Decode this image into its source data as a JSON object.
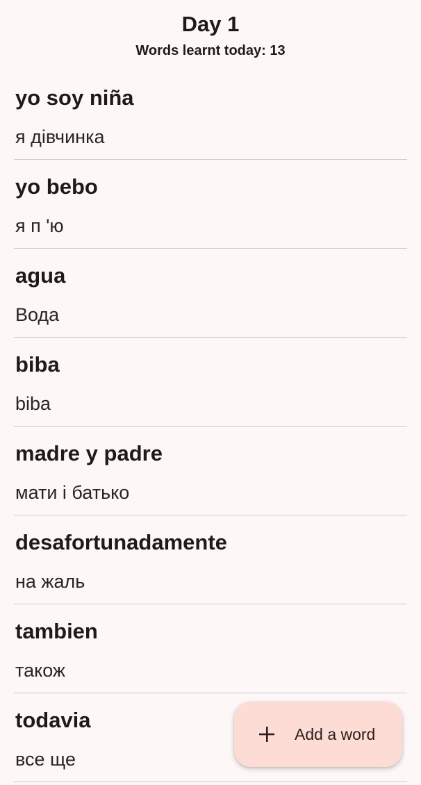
{
  "header": {
    "title": "Day 1",
    "subtitle": "Words learnt today: 13"
  },
  "words": [
    {
      "term": "yo soy niña",
      "translation": "я дівчинка"
    },
    {
      "term": "yo bebo",
      "translation": "я п 'ю"
    },
    {
      "term": "agua",
      "translation": "Вода"
    },
    {
      "term": "biba",
      "translation": "biba"
    },
    {
      "term": "madre y padre",
      "translation": "мати і батько"
    },
    {
      "term": "desafortunadamente",
      "translation": "на жаль"
    },
    {
      "term": "tambien",
      "translation": "також"
    },
    {
      "term": "todavia",
      "translation": "все ще"
    }
  ],
  "fab": {
    "label": "Add a word",
    "icon": "plus-icon",
    "background": "#fddcd6"
  },
  "colors": {
    "background": "#fdf8f7",
    "divider": "#cdc8cc",
    "text": "#1f1a19"
  }
}
